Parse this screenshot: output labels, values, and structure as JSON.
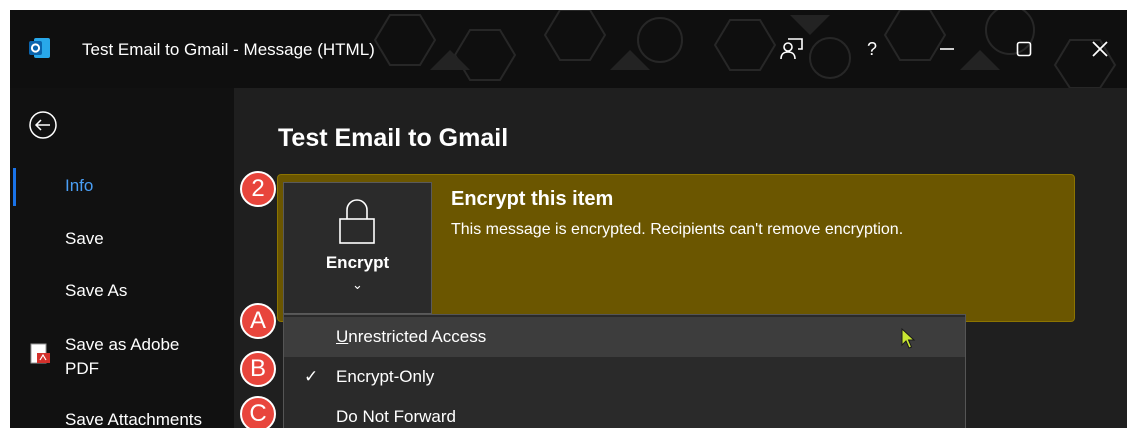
{
  "window": {
    "title": "Test Email to Gmail  -  Message (HTML)"
  },
  "title_bar_icons": [
    "outlook-logo-icon",
    "feedback-icon",
    "help-icon",
    "minimize-icon",
    "maximize-icon",
    "close-icon"
  ],
  "title_bar": {
    "help_label": "?"
  },
  "sidebar": {
    "items": [
      {
        "label": "Info",
        "active": true
      },
      {
        "label": "Save"
      },
      {
        "label": "Save As"
      },
      {
        "label": "Save as Adobe",
        "label_line2": "PDF",
        "icon": "adobe-pdf-icon"
      },
      {
        "label": "Save Attachments"
      }
    ]
  },
  "main": {
    "title": "Test Email to Gmail",
    "info_bar": {
      "heading": "Encrypt this item",
      "description": "This message is encrypted. Recipients can't remove encryption."
    },
    "encrypt_button": {
      "label": "Encrypt",
      "chevron": "⌄"
    },
    "dropdown": {
      "items": [
        {
          "label": "Unrestricted Access",
          "underline_first": true,
          "hovered": true
        },
        {
          "label": "Encrypt-Only",
          "checked": true,
          "check_glyph": "✓"
        },
        {
          "label": "Do Not Forward"
        }
      ]
    }
  },
  "annotations": {
    "badges": [
      "2",
      "A",
      "B",
      "C"
    ]
  },
  "colors": {
    "accent": "#4a9ff5",
    "info_bar": "#6b5600",
    "badge": "#e8453c",
    "cursor": "#c8e632"
  }
}
